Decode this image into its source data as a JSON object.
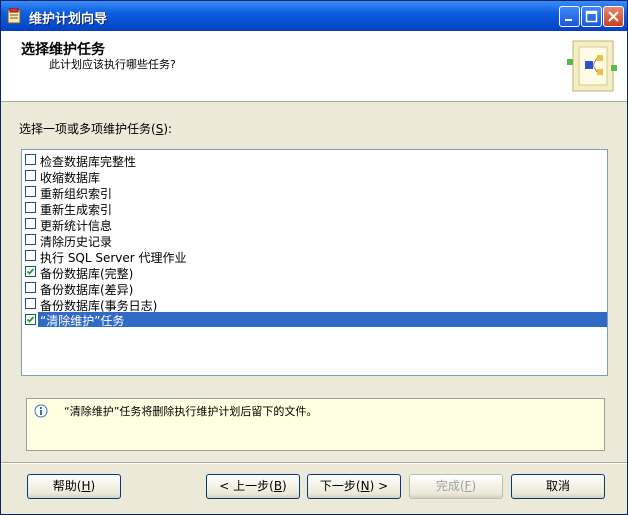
{
  "window": {
    "title": "维护计划向导"
  },
  "header": {
    "title": "选择维护任务",
    "subtitle": "此计划应该执行哪些任务?"
  },
  "list": {
    "label": "选择一项或多项维护任务",
    "label_mnemonic": "S",
    "label_suffix": "):",
    "items": [
      {
        "label": "检查数据库完整性",
        "checked": false
      },
      {
        "label": "收缩数据库",
        "checked": false
      },
      {
        "label": "重新组织索引",
        "checked": false
      },
      {
        "label": "重新生成索引",
        "checked": false
      },
      {
        "label": "更新统计信息",
        "checked": false
      },
      {
        "label": "清除历史记录",
        "checked": false
      },
      {
        "label": "执行 SQL Server 代理作业",
        "checked": false
      },
      {
        "label": "备份数据库(完整)",
        "checked": true
      },
      {
        "label": "备份数据库(差异)",
        "checked": false
      },
      {
        "label": "备份数据库(事务日志)",
        "checked": false
      },
      {
        "label": "“清除维护”任务",
        "checked": true,
        "selected": true
      }
    ]
  },
  "info": {
    "text": "“清除维护”任务将删除执行维护计划后留下的文件。",
    "icon": "info-icon"
  },
  "buttons": {
    "help": {
      "label": "帮助",
      "mnemonic": "H"
    },
    "back": {
      "prefix": "< 上一步",
      "mnemonic": "B"
    },
    "next": {
      "prefix": "下一步",
      "mnemonic": "N",
      "suffix": " >"
    },
    "finish": {
      "label": "完成",
      "mnemonic": "F"
    },
    "cancel": {
      "label": "取消"
    }
  }
}
